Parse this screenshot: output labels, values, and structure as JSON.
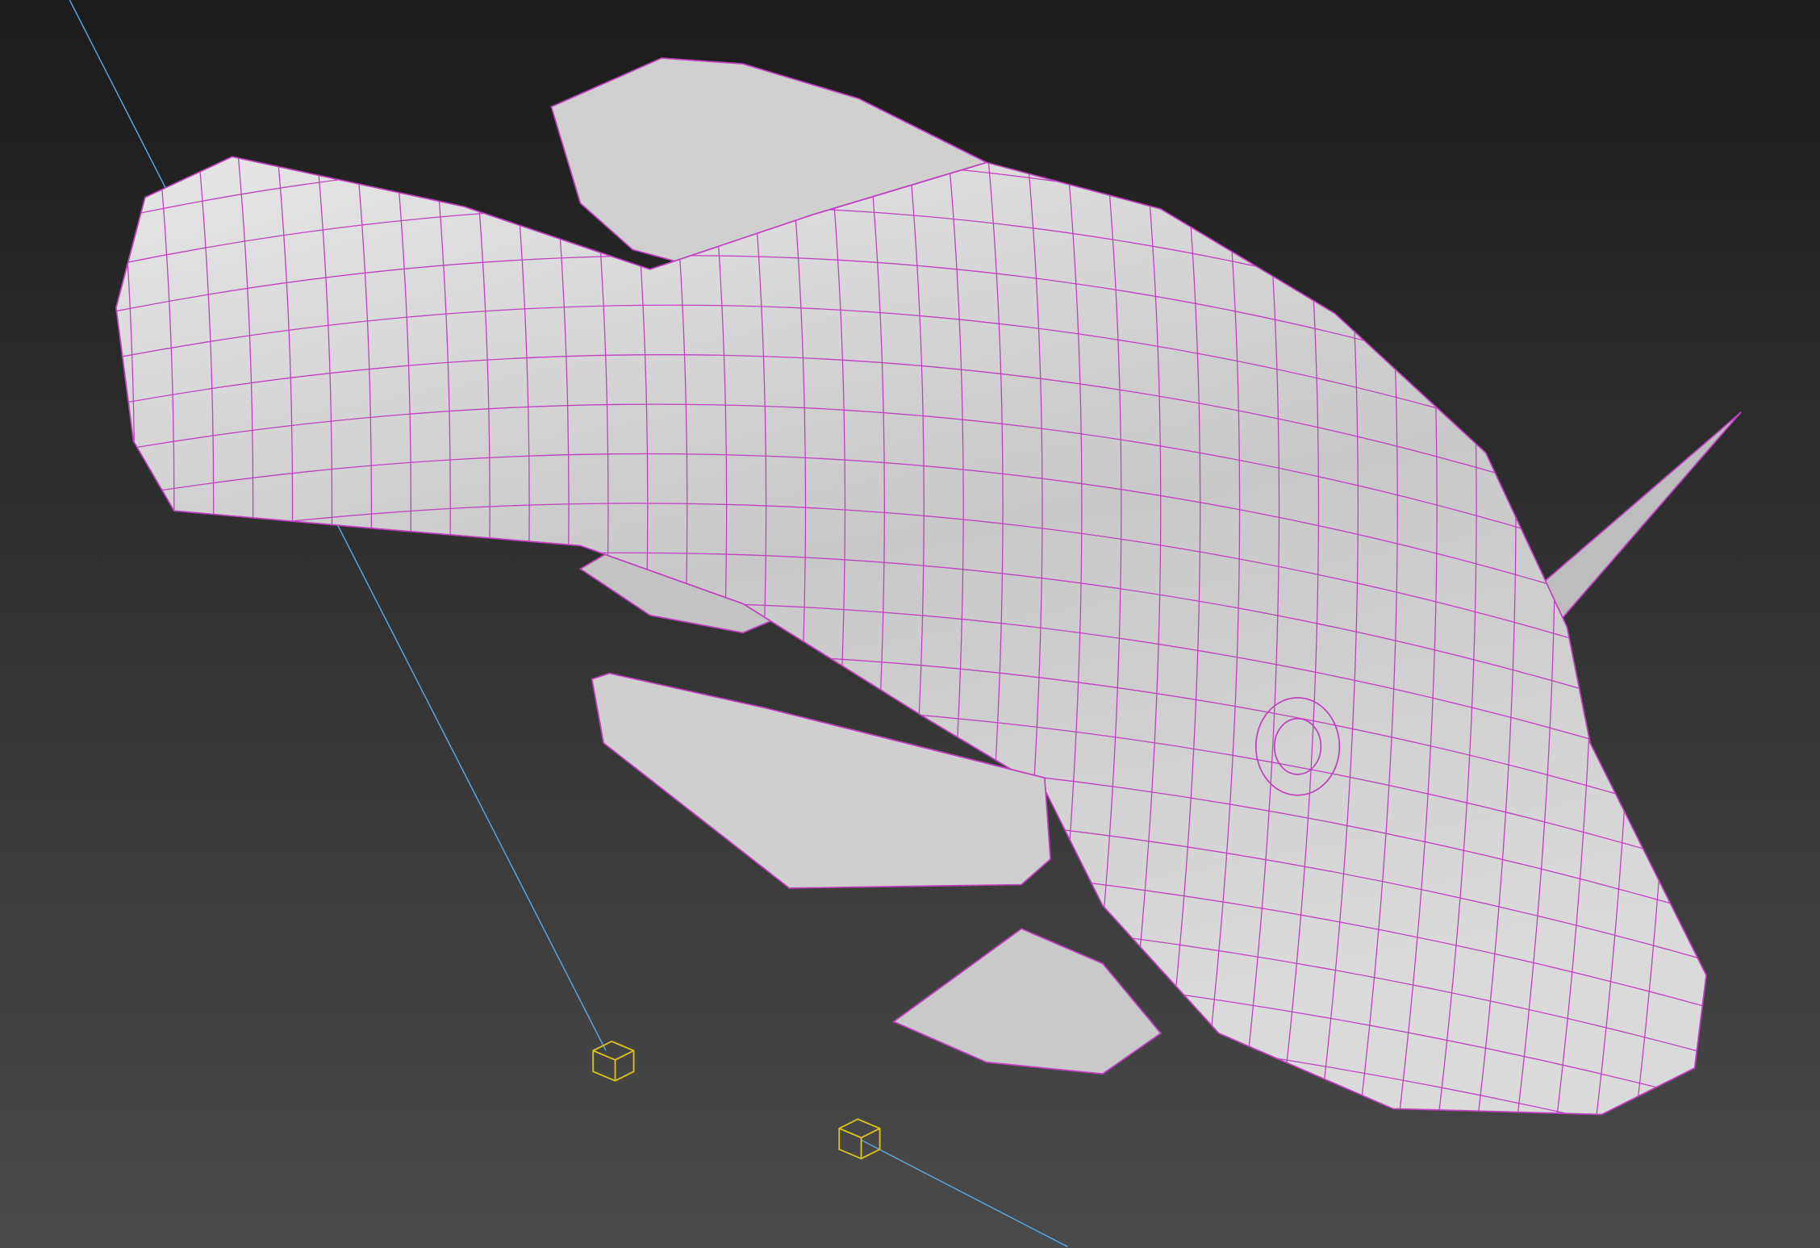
{
  "viewport": {
    "background_top": "#1c1c1c",
    "background_bottom": "#4a4a4a",
    "mesh_fill": "#d4d4d4",
    "mesh_shade": "#9a9a9a",
    "wireframe_color": "#c040c0",
    "link_line_color": "#5aa8e0",
    "helper_color": "#d8c020"
  },
  "objects": {
    "mesh": "fish-mesh",
    "helpers": [
      "dummy-helper-cube-icon",
      "dummy-helper-cube-icon"
    ]
  }
}
